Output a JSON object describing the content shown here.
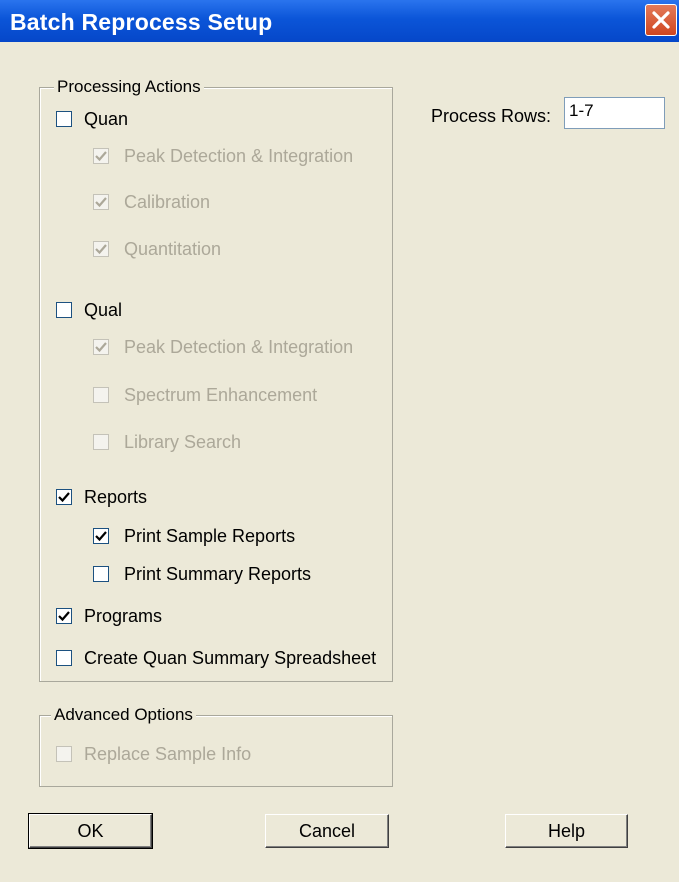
{
  "window": {
    "title": "Batch Reprocess Setup"
  },
  "processing_actions": {
    "legend": "Processing Actions",
    "quan": {
      "label": "Quan",
      "checked": false,
      "enabled": true,
      "children": [
        {
          "label": "Peak Detection & Integration",
          "checked": true,
          "enabled": false
        },
        {
          "label": "Calibration",
          "checked": true,
          "enabled": false
        },
        {
          "label": "Quantitation",
          "checked": true,
          "enabled": false
        }
      ]
    },
    "qual": {
      "label": "Qual",
      "checked": false,
      "enabled": true,
      "children": [
        {
          "label": "Peak Detection & Integration",
          "checked": true,
          "enabled": false
        },
        {
          "label": "Spectrum Enhancement",
          "checked": false,
          "enabled": false
        },
        {
          "label": "Library Search",
          "checked": false,
          "enabled": false
        }
      ]
    },
    "reports": {
      "label": "Reports",
      "checked": true,
      "enabled": true,
      "children": [
        {
          "label": "Print Sample Reports",
          "checked": true,
          "enabled": true
        },
        {
          "label": "Print Summary Reports",
          "checked": false,
          "enabled": true
        }
      ]
    },
    "programs": {
      "label": "Programs",
      "checked": true,
      "enabled": true
    },
    "quan_summary": {
      "label": "Create Quan Summary Spreadsheet",
      "checked": false,
      "enabled": true
    }
  },
  "advanced_options": {
    "legend": "Advanced Options",
    "replace_sample_info": {
      "label": "Replace Sample Info",
      "checked": false,
      "enabled": false
    }
  },
  "process_rows": {
    "label": "Process Rows:",
    "value": "1-7"
  },
  "buttons": {
    "ok": "OK",
    "cancel": "Cancel",
    "help": "Help"
  }
}
